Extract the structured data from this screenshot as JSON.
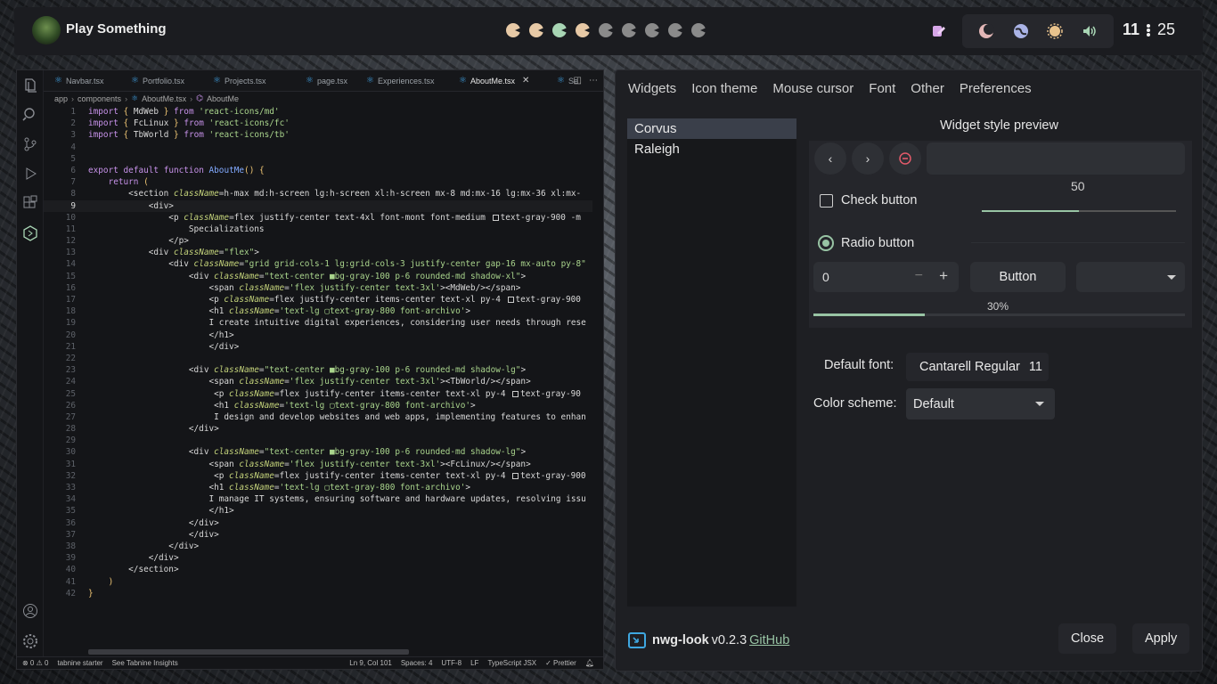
{
  "topbar": {
    "media_title": "Play Something",
    "workspace_count": 9,
    "clock_hour": "11",
    "clock_minute": "25"
  },
  "editor": {
    "tabs": [
      {
        "label": "Navbar.tsx"
      },
      {
        "label": "Portfolio.tsx"
      },
      {
        "label": "Projects.tsx"
      },
      {
        "label": "page.tsx"
      },
      {
        "label": "Experiences.tsx"
      },
      {
        "label": "AboutMe.tsx",
        "active": true
      },
      {
        "label": "Se"
      }
    ],
    "breadcrumb": [
      "app",
      "components",
      "AboutMe.tsx",
      "AboutMe"
    ],
    "code_lines": [
      "import { MdWeb } from 'react-icons/md'",
      "import { FcLinux } from 'react-icons/fc'",
      "import { TbWorld } from 'react-icons/tb'",
      "",
      "",
      "export default function AboutMe() {",
      "    return (",
      "        <section className=\"h-max md:h-screen lg:h-screen xl:h-screen mx-8 md:mx-16 lg:mx-36 xl:mx-",
      "            <div>",
      "                <p className=\"flex justify-center text-4xl font-mont font-medium ▢text-gray-900 -m",
      "                    Specializations",
      "                </p>",
      "            <div className=\"flex\">",
      "                <div className=\"grid grid-cols-1 lg:grid-cols-3 justify-center gap-16 mx-auto py-8\"",
      "                    <div className=\"text-center ■bg-gray-100 p-6 rounded-md shadow-xl\">",
      "                        <span className='flex justify-center text-3xl'><MdWeb/></span>",
      "                        <p className='flex justify-center items-center text-xl py-4 ▢text-gray-900",
      "                        <h1 className='text-lg ▢text-gray-800 font-archivo'>",
      "                        I create intuitive digital experiences, considering user needs through rese",
      "                        </h1>",
      "                        </div>",
      "",
      "                    <div className=\"text-center ■bg-gray-100 p-6 rounded-md shadow-lg\">",
      "                        <span className='flex justify-center text-3xl'><TbWorld/></span>",
      "                         <p className='flex justify-center items-center text-xl py-4 ▢text-gray-90",
      "                         <h1 className='text-lg ▢text-gray-800 font-archivo'>",
      "                         I design and develop websites and web apps, implementing features to enhan",
      "                    </div>",
      "",
      "                    <div className=\"text-center ■bg-gray-100 p-6 rounded-md shadow-lg\">",
      "                        <span className='flex justify-center text-3xl'><FcLinux/></span>",
      "                         <p className='flex justify-center items-center text-xl py-4 ▢text-gray-900",
      "                        <h1 className='text-lg ▢text-gray-800 font-archivo'>",
      "                        I manage IT systems, ensuring software and hardware updates, resolving issu",
      "                        </h1>",
      "                    </div>",
      "                    </div>",
      "                </div>",
      "            </div>",
      "        </section>",
      "    )",
      "}"
    ],
    "current_line": 9,
    "status": {
      "problems": "⊗ 0 ⚠ 0",
      "tabnine": "tabnine starter",
      "insights": "See Tabnine Insights",
      "position": "Ln 9, Col 101",
      "spaces": "Spaces: 4",
      "encoding": "UTF-8",
      "eol": "LF",
      "language": "TypeScript JSX",
      "formatter": "✓ Prettier"
    }
  },
  "nwg": {
    "tabs": [
      "Widgets",
      "Icon theme",
      "Mouse cursor",
      "Font",
      "Other",
      "Preferences"
    ],
    "themes": [
      {
        "name": "Corvus",
        "selected": true
      },
      {
        "name": "Raleigh"
      }
    ],
    "preview": {
      "title": "Widget style preview",
      "check_label": "Check button",
      "slider_value": "50",
      "slider_fraction": 0.5,
      "radio_label": "Radio button",
      "spin_value": "0",
      "button_label": "Button",
      "progress_text": "30%",
      "progress_fraction": 0.3
    },
    "default_font_label": "Default font:",
    "default_font_name": "Cantarell Regular",
    "default_font_size": "11",
    "color_scheme_label": "Color scheme:",
    "color_scheme_value": "Default",
    "footer": {
      "app": "nwg-look",
      "version": "v0.2.3",
      "link": "GitHub"
    },
    "close_label": "Close",
    "apply_label": "Apply"
  }
}
